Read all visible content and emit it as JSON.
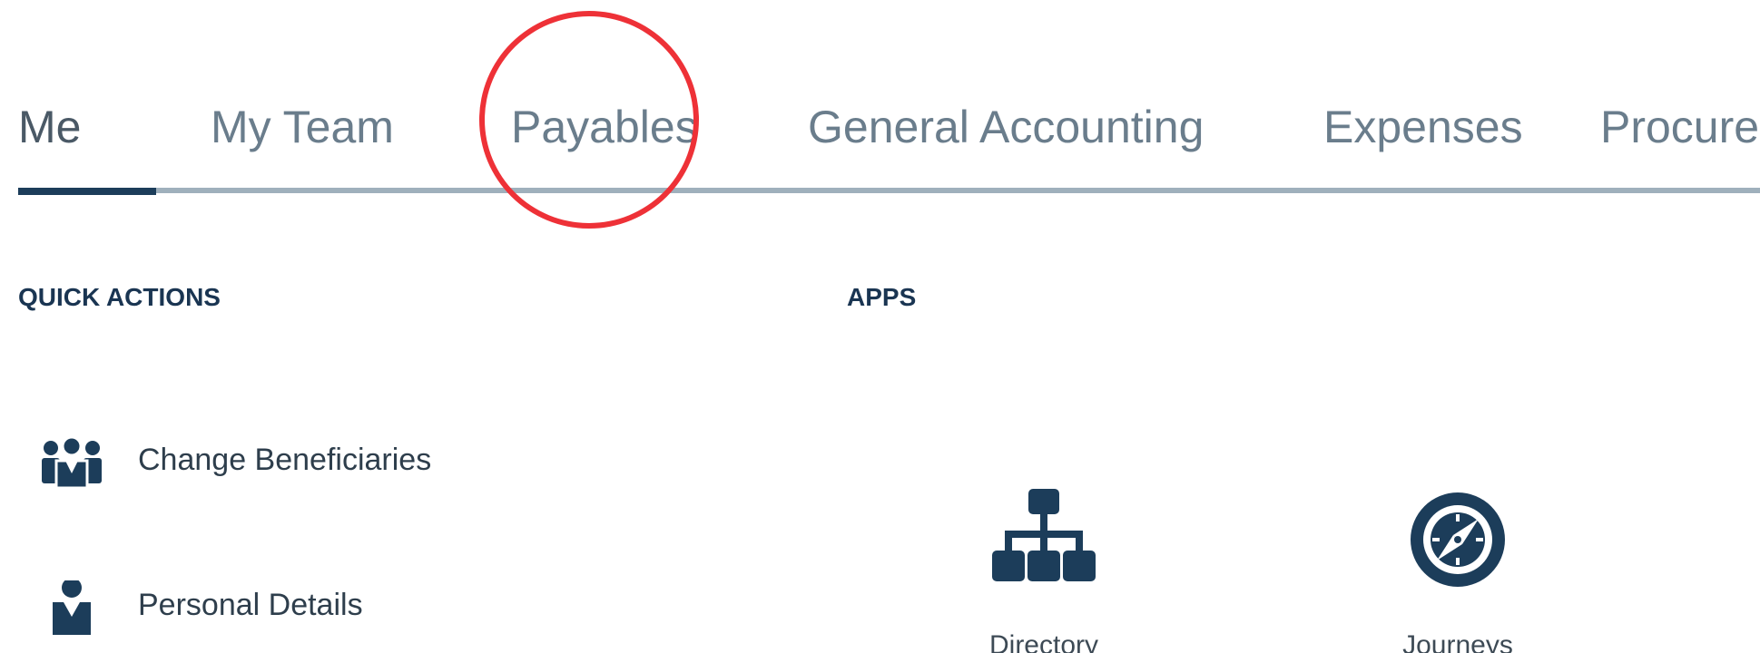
{
  "tabs": [
    {
      "label": "Me",
      "active": true
    },
    {
      "label": "My Team",
      "active": false
    },
    {
      "label": "Payables",
      "active": false,
      "highlighted": true
    },
    {
      "label": "General Accounting",
      "active": false
    },
    {
      "label": "Expenses",
      "active": false
    },
    {
      "label": "Procure",
      "active": false
    }
  ],
  "quick_actions": {
    "title": "QUICK ACTIONS",
    "items": [
      {
        "label": "Change Beneficiaries",
        "icon": "people-group-icon"
      },
      {
        "label": "Personal Details",
        "icon": "person-icon"
      }
    ]
  },
  "apps": {
    "title": "APPS",
    "items": [
      {
        "label": "Directory",
        "icon": "org-chart-icon"
      },
      {
        "label": "Journeys",
        "icon": "compass-icon"
      }
    ]
  },
  "colors": {
    "brand_navy": "#1c3d5a",
    "tab_text": "#6a7d8c",
    "highlight_ring": "#ee3137"
  }
}
